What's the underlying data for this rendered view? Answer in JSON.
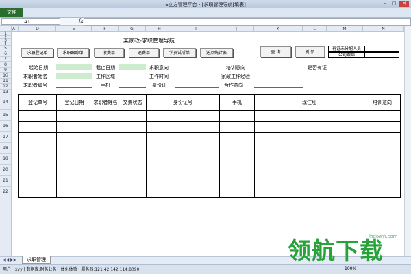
{
  "window": {
    "title": "E立方管理平台 - [求职管理导航[填表]",
    "min": "–",
    "max": "□",
    "close": "✕"
  },
  "ribbon": {
    "file_label": "文件"
  },
  "formula_bar": {
    "cell_ref": "A1",
    "fx": "fx",
    "formula": ""
  },
  "columns": [
    "A",
    "B",
    "D",
    "E",
    "F",
    "G",
    "H",
    "I",
    "J",
    "K",
    "L",
    "M",
    "N"
  ],
  "rows": [
    "1",
    "2",
    "3",
    "4",
    "5",
    "6",
    "7",
    "8",
    "9",
    "10",
    "11",
    "12",
    "13",
    "14",
    "15",
    "16",
    "17",
    "18",
    "19",
    "20",
    "21",
    "22"
  ],
  "sheet_title": "某家政-求职管理导航",
  "buttons": {
    "register": "求职登记单",
    "followup": "求职跟踪单",
    "fee": "收费单",
    "refund": "退费单",
    "trial": "学员试听单",
    "stats": "送点统计表",
    "query": "查 询",
    "refresh": "刷 新"
  },
  "info": {
    "unassigned": "有证未分配人员",
    "company": "公司跟踪"
  },
  "form": {
    "start_date": "起始日期",
    "end_date": "截止日期",
    "intent": "求职意向",
    "training": "培训意向",
    "has_cert": "是否有证",
    "name": "求职者姓名",
    "work_area": "工作区域",
    "work_time": "工作时间",
    "experience": "家政工作经验",
    "number": "求职者编号",
    "phone": "手机",
    "id_card": "身份证",
    "coop": "合作意向"
  },
  "table": {
    "headers": [
      "登记单号",
      "登记日期",
      "求职者姓名",
      "交费状态",
      "身份证号",
      "手机",
      "现住址",
      "培训意向"
    ],
    "row_count": 8
  },
  "tabs": {
    "active": "求职管理"
  },
  "status": {
    "text": "用户：xyy | 数据库:财务业务一体化体验 | 服务器:121.42.142.114:8090",
    "zoom": "100%"
  },
  "watermark": {
    "text": "领航下载",
    "site": "lhdown.com",
    "color": "#27a33a"
  }
}
